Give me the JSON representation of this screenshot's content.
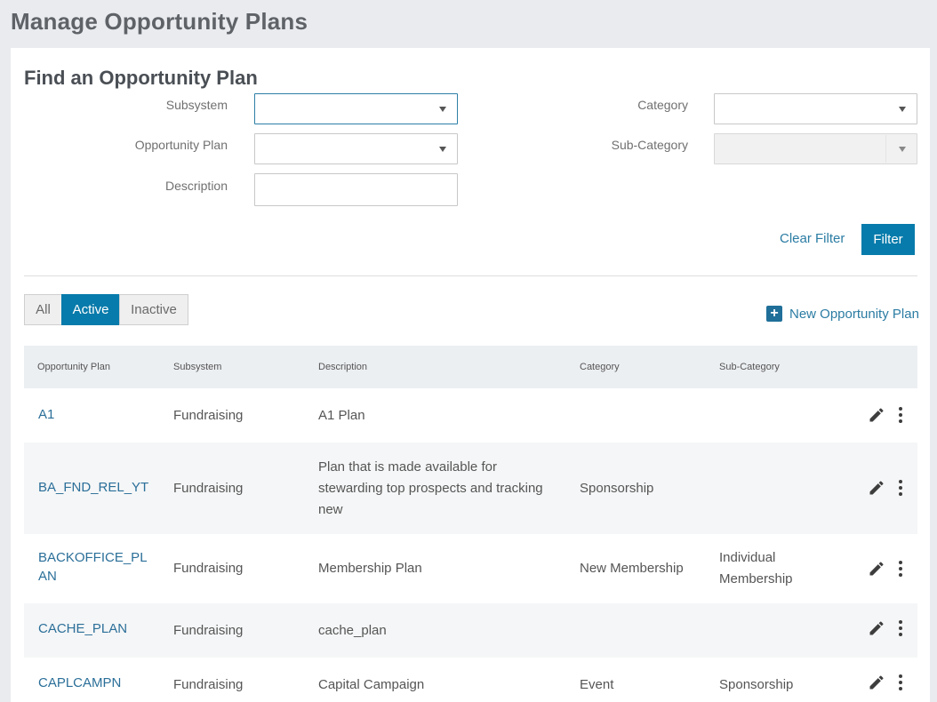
{
  "page": {
    "title": "Manage Opportunity Plans"
  },
  "filter": {
    "title": "Find an Opportunity Plan",
    "subsystem_label": "Subsystem",
    "subsystem_value": "",
    "opportunity_plan_label": "Opportunity Plan",
    "opportunity_plan_value": "",
    "description_label": "Description",
    "description_value": "",
    "category_label": "Category",
    "category_value": "",
    "subcategory_label": "Sub-Category",
    "subcategory_value": "",
    "clear_label": "Clear Filter",
    "filter_label": "Filter"
  },
  "status_tabs": [
    {
      "label": "All",
      "active": false
    },
    {
      "label": "Active",
      "active": true
    },
    {
      "label": "Inactive",
      "active": false
    }
  ],
  "new_plan_label": "New Opportunity Plan",
  "table": {
    "headers": [
      "Opportunity Plan",
      "Subsystem",
      "Description",
      "Category",
      "Sub-Category"
    ],
    "rows": [
      {
        "plan": "A1",
        "subsystem": "Fundraising",
        "description": "A1 Plan",
        "category": "",
        "subcategory": ""
      },
      {
        "plan": "BA_FND_REL_YT",
        "subsystem": "Fundraising",
        "description": "Plan that is made available for stewarding top prospects and tracking new",
        "category": "Sponsorship",
        "subcategory": ""
      },
      {
        "plan": "BACKOFFICE_PLAN",
        "subsystem": "Fundraising",
        "description": "Membership Plan",
        "category": "New Membership",
        "subcategory": "Individual Membership"
      },
      {
        "plan": "CACHE_PLAN",
        "subsystem": "Fundraising",
        "description": "cache_plan",
        "category": "",
        "subcategory": ""
      },
      {
        "plan": "CAPLCAMPN",
        "subsystem": "Fundraising",
        "description": "Capital Campaign",
        "category": "Event",
        "subcategory": "Sponsorship"
      }
    ]
  },
  "icons": {
    "edit": "pencil-icon",
    "more": "more-vertical-icon",
    "add": "plus-square-icon",
    "dropdown": "caret-down-icon"
  },
  "colors": {
    "accent": "#077bab",
    "link": "#2b7ca3",
    "header_bg": "#eceff2",
    "alt_row": "#f5f6f7"
  }
}
